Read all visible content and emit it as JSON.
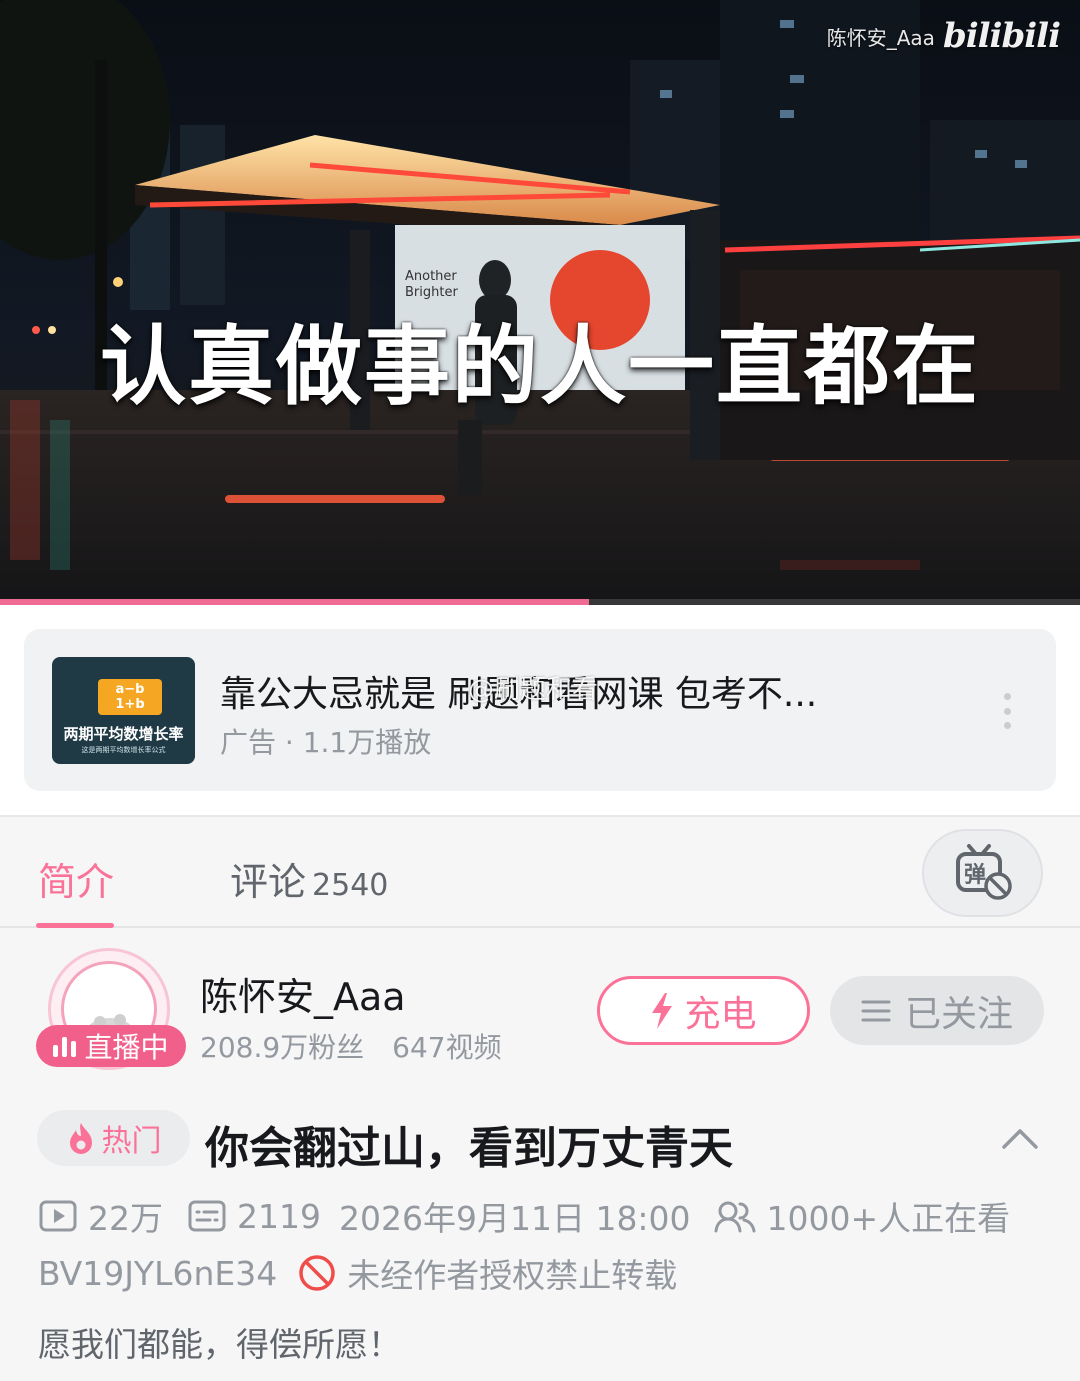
{
  "player": {
    "watermark_user": "陈怀安_Aaa",
    "watermark_logo": "bilibili",
    "caption": "认真做事的人一直都在",
    "billboard_text": "Another Brighter",
    "progress": 0.545
  },
  "ad": {
    "title": "靠公大忌就是 刷题和看网课 包考不...",
    "meta": "广告 · 1.1万播放",
    "thumb_formula_top": "a−b",
    "thumb_formula_bottom": "1+b",
    "thumb_title": "两期平均数增长率",
    "thumb_sub": "这是两期平均数增长率公式",
    "overlay_watermark": "@刷题和看"
  },
  "tabs": {
    "intro_label": "简介",
    "comment_label": "评论",
    "comment_count": "2540"
  },
  "uploader": {
    "name": "陈怀安_Aaa",
    "live_label": "直播中",
    "followers": "208.9万粉丝",
    "videos": "647视频",
    "charge_label": "充电",
    "follow_label": "已关注"
  },
  "video": {
    "hot_label": "热门",
    "title": "你会翻过山，看到万丈青天",
    "plays": "22万",
    "danmaku": "2119",
    "date": "2026年9月11日 18:00",
    "watching": "1000+人正在看",
    "bvid": "BV19JYL6nE34",
    "copyright": "未经作者授权禁止转载",
    "description": "愿我们都能，得偿所愿！"
  },
  "colors": {
    "accent": "#fb7299",
    "live": "#f15f8b",
    "text_secondary": "#9499a0"
  },
  "icons": [
    "play-count-icon",
    "danmaku-count-icon",
    "viewers-icon",
    "forbid-icon",
    "fire-icon",
    "lightning-icon",
    "menu-lines-icon",
    "chevron-up-icon",
    "danmaku-toggle-icon",
    "more-icon"
  ]
}
